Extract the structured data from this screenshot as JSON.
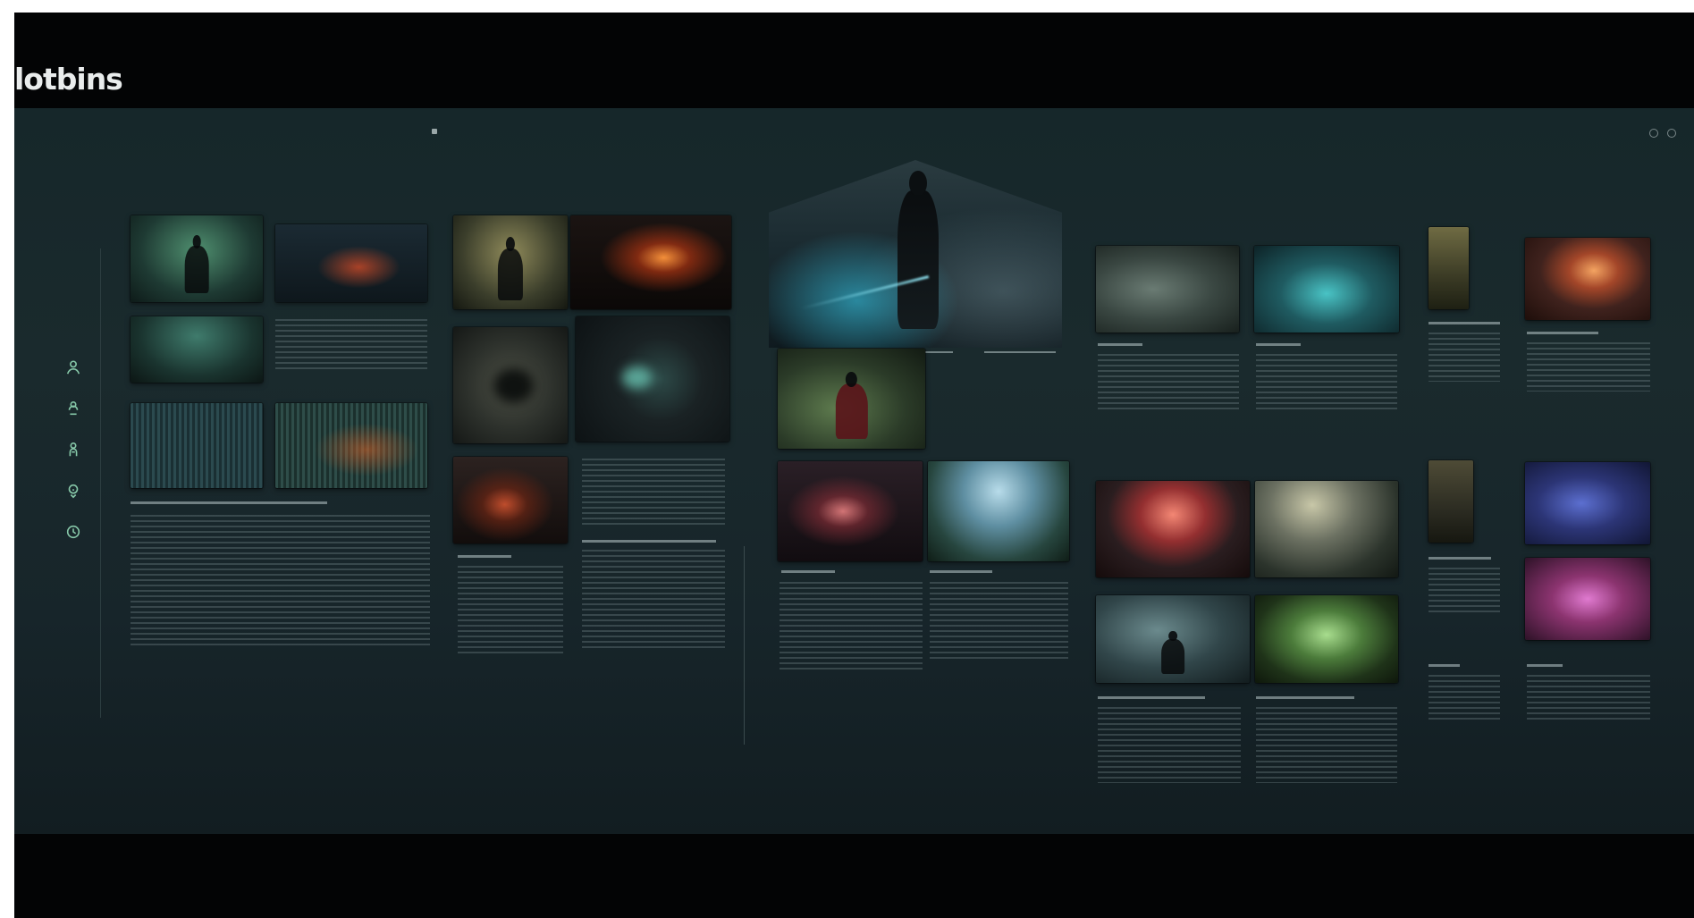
{
  "app": {
    "title": "lotbins"
  },
  "colors": {
    "frame_background": "#030405",
    "screen_background": "#17262a",
    "accent_icon": "#86c7a8",
    "text_muted": "#6d7d7f"
  },
  "side_icons": [
    "person-icon",
    "group-icon",
    "figure-icon",
    "key-icon",
    "clock-icon"
  ]
}
